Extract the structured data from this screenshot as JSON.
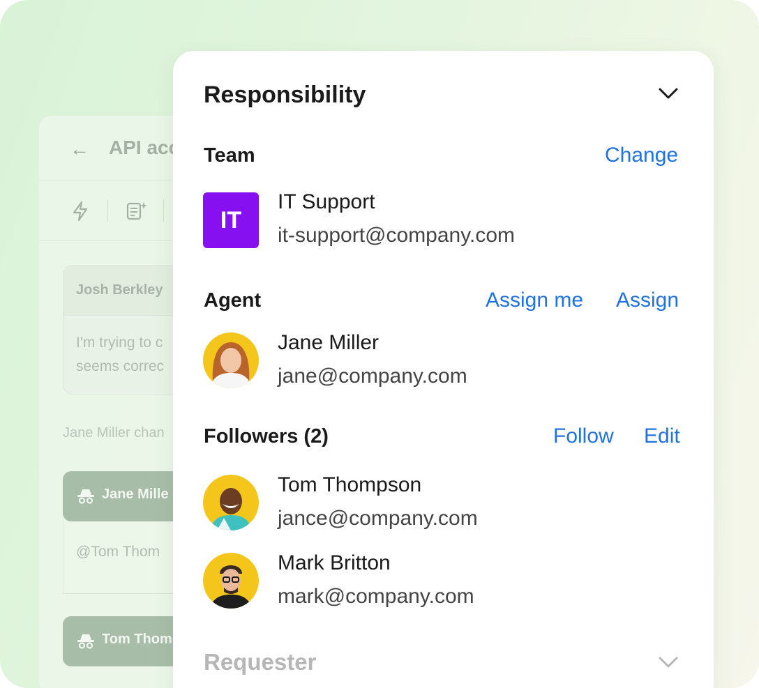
{
  "background_ticket": {
    "back_icon": "arrow-left-icon",
    "title": "API acc",
    "toolbar_icons": [
      "bolt-icon",
      "ai-document-icon"
    ],
    "message": {
      "author": "Josh Berkley",
      "line1": "I'm trying to c",
      "line2": "seems correc"
    },
    "system_note": "Jane Miller chan",
    "notes": [
      {
        "author": "Jane Mille",
        "text": "@Tom Thom"
      },
      {
        "author": "Tom Thom",
        "text": ""
      }
    ]
  },
  "panel": {
    "title": "Responsibility",
    "collapse_icon": "chevron-down-icon",
    "team": {
      "label": "Team",
      "action": "Change",
      "badge": "IT",
      "name": "IT Support",
      "email": "it-support@company.com"
    },
    "agent": {
      "label": "Agent",
      "actions": [
        "Assign me",
        "Assign"
      ],
      "name": "Jane Miller",
      "email": "jane@company.com"
    },
    "followers": {
      "label": "Followers (2)",
      "actions": [
        "Follow",
        "Edit"
      ],
      "people": [
        {
          "name": "Tom Thompson",
          "email": "jance@company.com"
        },
        {
          "name": "Mark Britton",
          "email": "mark@company.com"
        }
      ]
    },
    "requester": {
      "label": "Requester",
      "expand_icon": "chevron-down-icon"
    }
  },
  "colors": {
    "accent_link": "#1f73e0",
    "team_badge": "#8610ef",
    "avatar_bg": "#f4c51a",
    "background_gradient_start": "#d9f3d7"
  }
}
